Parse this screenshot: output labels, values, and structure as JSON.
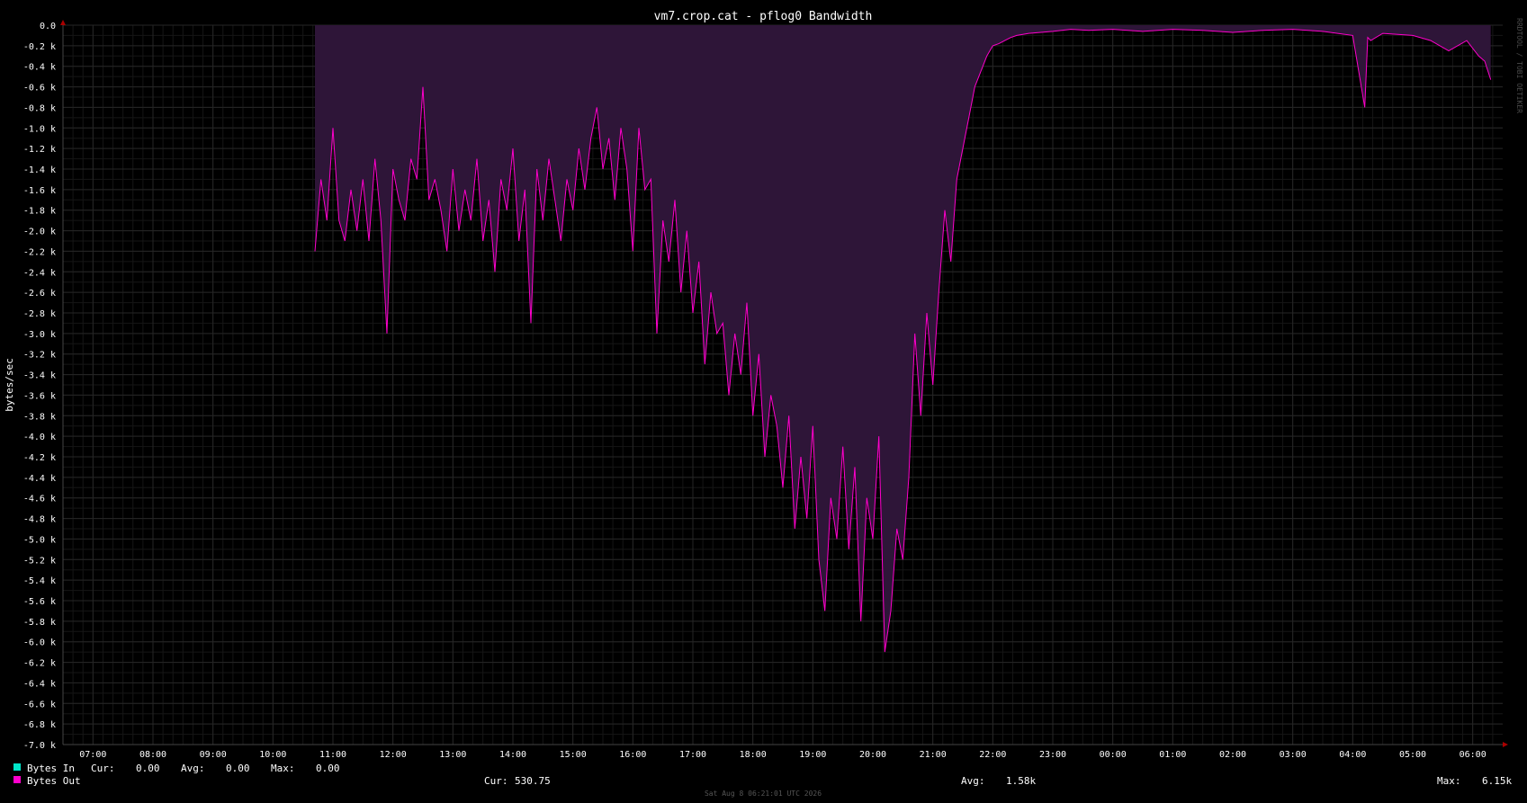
{
  "chart_data": {
    "type": "area",
    "title": "vm7.crop.cat - pflog0 Bandwidth",
    "ylabel": "bytes/sec",
    "ylim": [
      -7000,
      0
    ],
    "y_ticks": [
      "0.0",
      "-0.2 k",
      "-0.4 k",
      "-0.6 k",
      "-0.8 k",
      "-1.0 k",
      "-1.2 k",
      "-1.4 k",
      "-1.6 k",
      "-1.8 k",
      "-2.0 k",
      "-2.2 k",
      "-2.4 k",
      "-2.6 k",
      "-2.8 k",
      "-3.0 k",
      "-3.2 k",
      "-3.4 k",
      "-3.6 k",
      "-3.8 k",
      "-4.0 k",
      "-4.2 k",
      "-4.4 k",
      "-4.6 k",
      "-4.8 k",
      "-5.0 k",
      "-5.2 k",
      "-5.4 k",
      "-5.6 k",
      "-5.8 k",
      "-6.0 k",
      "-6.2 k",
      "-6.4 k",
      "-6.6 k",
      "-6.8 k",
      "-7.0 k"
    ],
    "x_ticks": [
      "07:00",
      "08:00",
      "09:00",
      "10:00",
      "11:00",
      "12:00",
      "13:00",
      "14:00",
      "15:00",
      "16:00",
      "17:00",
      "18:00",
      "19:00",
      "20:00",
      "21:00",
      "22:00",
      "23:00",
      "00:00",
      "01:00",
      "02:00",
      "03:00",
      "04:00",
      "05:00",
      "06:00"
    ],
    "grid": true,
    "series": [
      {
        "name": "Bytes Out",
        "color": "#ff00cc",
        "fill": "#2e1538",
        "x_hours": [
          10.7,
          10.8,
          10.9,
          11.0,
          11.1,
          11.2,
          11.3,
          11.4,
          11.5,
          11.6,
          11.7,
          11.8,
          11.9,
          12.0,
          12.1,
          12.2,
          12.3,
          12.4,
          12.5,
          12.6,
          12.7,
          12.8,
          12.9,
          13.0,
          13.1,
          13.2,
          13.3,
          13.4,
          13.5,
          13.6,
          13.7,
          13.8,
          13.9,
          14.0,
          14.1,
          14.2,
          14.3,
          14.4,
          14.5,
          14.6,
          14.7,
          14.8,
          14.9,
          15.0,
          15.1,
          15.2,
          15.3,
          15.4,
          15.5,
          15.6,
          15.7,
          15.8,
          15.9,
          16.0,
          16.1,
          16.2,
          16.3,
          16.4,
          16.5,
          16.6,
          16.7,
          16.8,
          16.9,
          17.0,
          17.1,
          17.2,
          17.3,
          17.4,
          17.5,
          17.6,
          17.7,
          17.8,
          17.9,
          18.0,
          18.1,
          18.2,
          18.3,
          18.4,
          18.5,
          18.6,
          18.7,
          18.8,
          18.9,
          19.0,
          19.1,
          19.2,
          19.3,
          19.4,
          19.5,
          19.6,
          19.7,
          19.8,
          19.9,
          20.0,
          20.1,
          20.2,
          20.3,
          20.4,
          20.5,
          20.6,
          20.7,
          20.8,
          20.9,
          21.0,
          21.1,
          21.2,
          21.3,
          21.4,
          21.5,
          21.6,
          21.7,
          21.8,
          21.9,
          22.0,
          22.1,
          22.2,
          22.3,
          22.4,
          22.5,
          22.6,
          22.8,
          23.0,
          23.3,
          23.6,
          24.0,
          24.5,
          25.0,
          25.5,
          26.0,
          26.5,
          27.0,
          27.5,
          28.0,
          28.2,
          28.25,
          28.3,
          28.5,
          29.0,
          29.3,
          29.6,
          29.9,
          30.1,
          30.2,
          30.3
        ],
        "values": [
          -2200,
          -1500,
          -1900,
          -1000,
          -1900,
          -2100,
          -1600,
          -2000,
          -1500,
          -2100,
          -1300,
          -1900,
          -3000,
          -1400,
          -1700,
          -1900,
          -1300,
          -1500,
          -600,
          -1700,
          -1500,
          -1800,
          -2200,
          -1400,
          -2000,
          -1600,
          -1900,
          -1300,
          -2100,
          -1700,
          -2400,
          -1500,
          -1800,
          -1200,
          -2100,
          -1600,
          -2900,
          -1400,
          -1900,
          -1300,
          -1700,
          -2100,
          -1500,
          -1800,
          -1200,
          -1600,
          -1100,
          -800,
          -1400,
          -1100,
          -1700,
          -1000,
          -1400,
          -2200,
          -1000,
          -1600,
          -1500,
          -3000,
          -1900,
          -2300,
          -1700,
          -2600,
          -2000,
          -2800,
          -2300,
          -3300,
          -2600,
          -3000,
          -2900,
          -3600,
          -3000,
          -3400,
          -2700,
          -3800,
          -3200,
          -4200,
          -3600,
          -3900,
          -4500,
          -3800,
          -4900,
          -4200,
          -4800,
          -3900,
          -5200,
          -5700,
          -4600,
          -5000,
          -4100,
          -5100,
          -4300,
          -5800,
          -4600,
          -5000,
          -4000,
          -6100,
          -5700,
          -4900,
          -5200,
          -4400,
          -3000,
          -3800,
          -2800,
          -3500,
          -2600,
          -1800,
          -2300,
          -1500,
          -1200,
          -900,
          -600,
          -450,
          -300,
          -200,
          -180,
          -150,
          -120,
          -100,
          -90,
          -80,
          -70,
          -60,
          -40,
          -50,
          -40,
          -60,
          -40,
          -50,
          -70,
          -50,
          -40,
          -60,
          -100,
          -800,
          -120,
          -150,
          -80,
          -100,
          -150,
          -250,
          -150,
          -300,
          -350,
          -530
        ]
      }
    ]
  },
  "legend": [
    {
      "name": "Bytes In",
      "color": "#00e5c8",
      "cur_label": "Cur:",
      "cur": "0.00",
      "avg_label": "Avg:",
      "avg": "0.00",
      "max_label": "Max:",
      "max": "0.00"
    },
    {
      "name": "Bytes Out",
      "color": "#ff00cc",
      "cur_label": "Cur:",
      "cur": "530.75",
      "avg_label": "Avg:",
      "avg": "1.58k",
      "max_label": "Max:",
      "max": "6.15k"
    }
  ],
  "footer_timestamp": "Sat Aug  8 06:21:01 UTC 2026",
  "watermark": "RRDTOOL / TOBI OETIKER"
}
